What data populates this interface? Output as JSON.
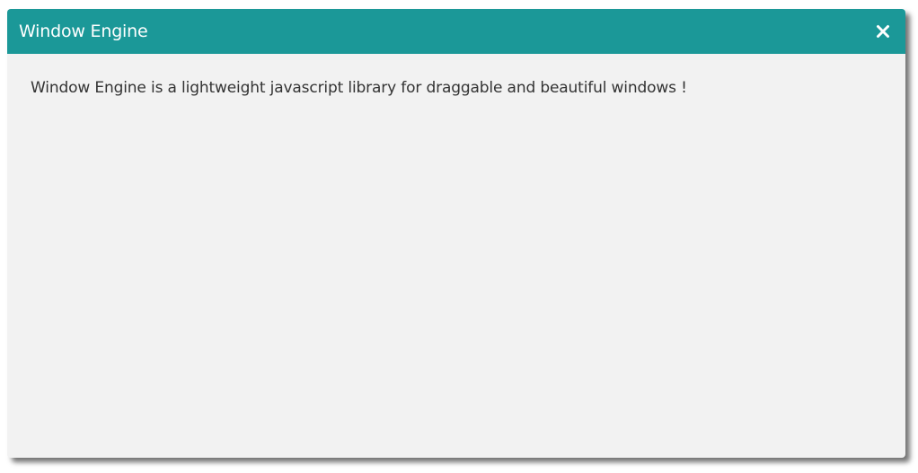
{
  "window": {
    "title": "Window Engine",
    "close_icon": "close-icon",
    "body_text": "Window Engine is a lightweight javascript library for draggable and beautiful windows !"
  },
  "colors": {
    "titlebar": "#1b9898",
    "body_background": "#f2f2f2",
    "title_text": "#ffffff",
    "body_text": "#333333"
  }
}
